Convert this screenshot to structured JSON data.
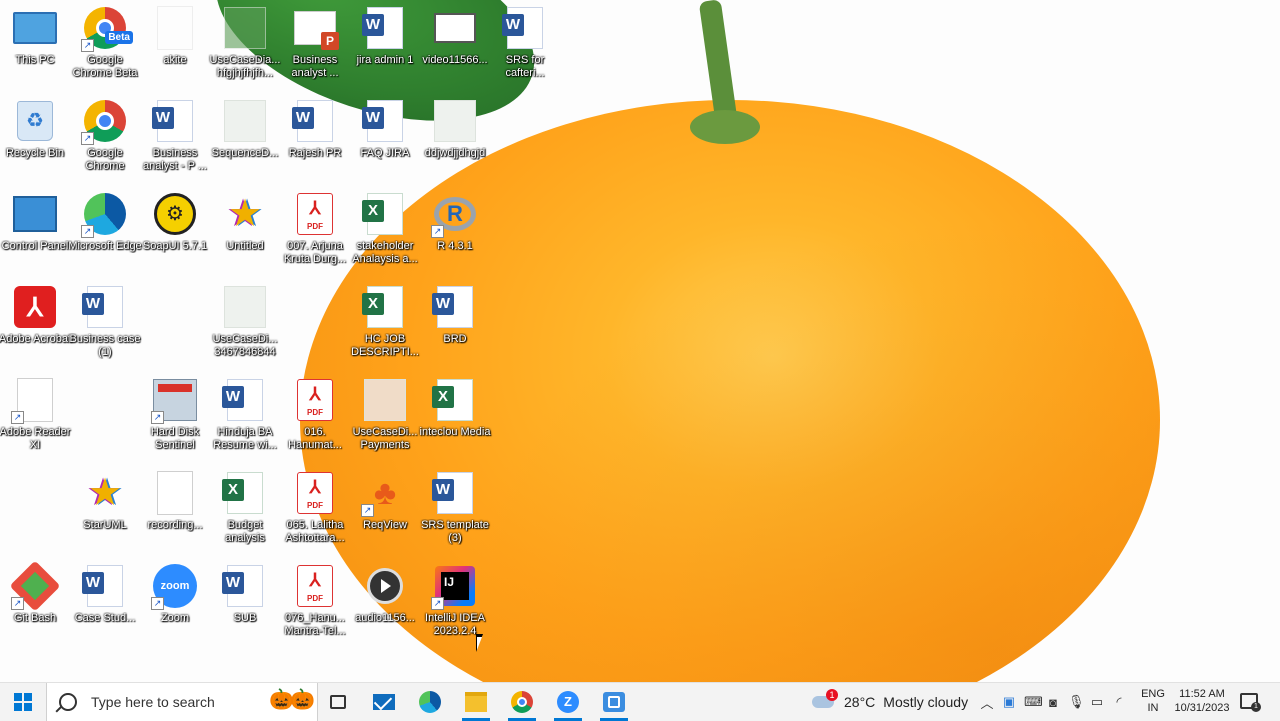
{
  "desktop": {
    "icons": [
      {
        "label": "This PC",
        "icon": "this-pc-icon"
      },
      {
        "label": "Google Chrome Beta",
        "icon": "chrome-beta-icon",
        "badge": "Beta"
      },
      {
        "label": "akite",
        "icon": "blank-file-icon"
      },
      {
        "label": "UseCaseDia... hfgjhjfhjfh...",
        "icon": "diagram-file-icon"
      },
      {
        "label": "Business analyst ...",
        "icon": "powerpoint-file-icon"
      },
      {
        "label": "jira admin 1",
        "icon": "word-file-icon"
      },
      {
        "label": "video11566...",
        "icon": "video-file-icon"
      },
      {
        "label": "SRS for cafteri...",
        "icon": "word-file-icon"
      },
      {
        "label": "Recycle Bin",
        "icon": "recycle-bin-icon"
      },
      {
        "label": "Google Chrome",
        "icon": "chrome-icon"
      },
      {
        "label": "Business analyst - P ...",
        "icon": "word-file-icon"
      },
      {
        "label": "SequenceD...",
        "icon": "diagram-file-icon"
      },
      {
        "label": "Rajesh PR",
        "icon": "word-file-icon"
      },
      {
        "label": "FAQ JIRA",
        "icon": "word-file-icon"
      },
      {
        "label": "ddjwdjjdhgjd",
        "icon": "diagram-file-icon"
      },
      {
        "label": "Control Panel",
        "icon": "control-panel-icon"
      },
      {
        "label": "Microsoft Edge",
        "icon": "edge-icon"
      },
      {
        "label": "SoapUI 5.7.1",
        "icon": "soapui-icon"
      },
      {
        "label": "Untitled",
        "icon": "staruml-icon"
      },
      {
        "label": "007. Arjuna Kruta Durg...",
        "icon": "pdf-file-icon"
      },
      {
        "label": "stakeholder Analaysis a...",
        "icon": "excel-file-icon"
      },
      {
        "label": "R 4.3.1",
        "icon": "r-lang-icon"
      },
      {
        "label": "Adobe Acrobat",
        "icon": "adobe-acrobat-icon"
      },
      {
        "label": "Business case (1)",
        "icon": "word-file-icon"
      },
      {
        "label": "UseCaseDi... 3467846844",
        "icon": "diagram-file-icon"
      },
      {
        "label": "HC JOB DESCRIPTI...",
        "icon": "excel-file-icon"
      },
      {
        "label": "BRD",
        "icon": "word-file-icon"
      },
      {
        "label": "Adobe Reader XI",
        "icon": "blank-file-icon"
      },
      {
        "label": "Hard Disk Sentinel",
        "icon": "hard-disk-sentinel-icon"
      },
      {
        "label": "Hinduja BA Resume wi...",
        "icon": "word-file-icon"
      },
      {
        "label": "016. Hanumat...",
        "icon": "pdf-file-icon"
      },
      {
        "label": "UseCaseDi... Payments",
        "icon": "diagram-file-icon"
      },
      {
        "label": "inteclou Media",
        "icon": "excel-file-icon"
      },
      {
        "label": "StarUML",
        "icon": "staruml-icon"
      },
      {
        "label": "recording...",
        "icon": "blank-file-icon"
      },
      {
        "label": "Budget analysis",
        "icon": "excel-file-icon"
      },
      {
        "label": "065. Lalitha Ashtottara...",
        "icon": "pdf-file-icon"
      },
      {
        "label": "ReqView",
        "icon": "reqview-icon"
      },
      {
        "label": "SRS template (3)",
        "icon": "word-file-icon"
      },
      {
        "label": "Git Bash",
        "icon": "git-bash-icon"
      },
      {
        "label": "Case Stud...",
        "icon": "word-file-icon"
      },
      {
        "label": "Zoom",
        "icon": "zoom-icon",
        "badge": "zoom"
      },
      {
        "label": "SUB",
        "icon": "word-file-icon"
      },
      {
        "label": "076_Hanu... Mantra-Tel...",
        "icon": "pdf-file-icon"
      },
      {
        "label": "audio1156...",
        "icon": "audio-file-icon"
      },
      {
        "label": "IntelliJ IDEA 2023.2.4",
        "icon": "intellij-icon"
      }
    ]
  },
  "taskbar": {
    "search_placeholder": "Type here to search",
    "weather": {
      "temp": "28°C",
      "condition": "Mostly cloudy",
      "badge": "1"
    },
    "language": {
      "line1": "ENG",
      "line2": "IN"
    },
    "clock": {
      "time": "11:52 AM",
      "date": "10/31/2023"
    },
    "notification_count": "1",
    "apps": [
      "task-view",
      "mail",
      "edge",
      "file-explorer",
      "chrome",
      "zoom",
      "snipping-tool"
    ]
  },
  "colors": {
    "accent": "#0078d4",
    "wallpaper_orange": "#ffa21a",
    "taskbar_bg": "#f3f3f3"
  }
}
